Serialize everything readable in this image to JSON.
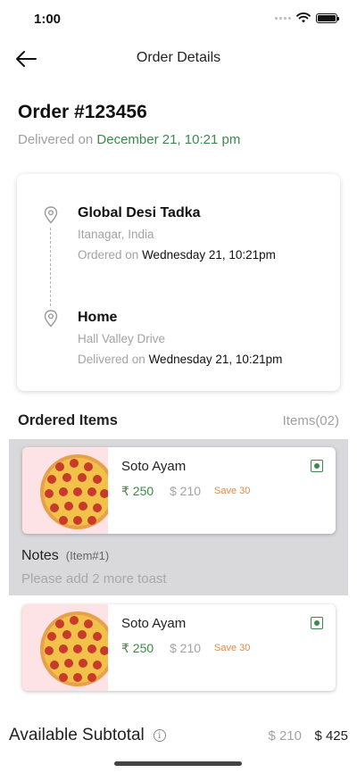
{
  "status": {
    "time": "1:00"
  },
  "nav": {
    "title": "Order Details"
  },
  "order": {
    "title": "Order #123456",
    "delivered_prefix": "Delivered on",
    "delivered_date": "December 21, 10:21 pm"
  },
  "route": {
    "origin": {
      "name": "Global Desi Tadka",
      "location": "Itanagar, India",
      "time_prefix": "Ordered on",
      "time": "Wednesday 21, 10:21pm"
    },
    "destination": {
      "name": "Home",
      "location": "Hall Valley Drive",
      "time_prefix": "Delivered on",
      "time": "Wednesday 21, 10:21pm"
    }
  },
  "items_section": {
    "heading": "Ordered Items",
    "count": "Items(02)"
  },
  "items": [
    {
      "name": "Soto Ayam",
      "price": "₹ 250",
      "old_price": "$ 210",
      "save": "Save 30",
      "icon": "veg-mark-icon"
    },
    {
      "name": "Soto Ayam",
      "price": "₹ 250",
      "old_price": "$ 210",
      "save": "Save 30",
      "icon": "veg-mark-icon"
    }
  ],
  "notes": {
    "label": "Notes",
    "item_ref": "(Item#1)",
    "text": "Please add 2 more toast"
  },
  "subtotal": {
    "label": "Available Subtotal",
    "old": "$ 210",
    "new": "$ 425"
  },
  "colors": {
    "accent_green": "#3b8a4c",
    "save_orange": "#e08a4a",
    "panel_grey": "#d9d9dc",
    "image_bg": "#fde3e6"
  }
}
